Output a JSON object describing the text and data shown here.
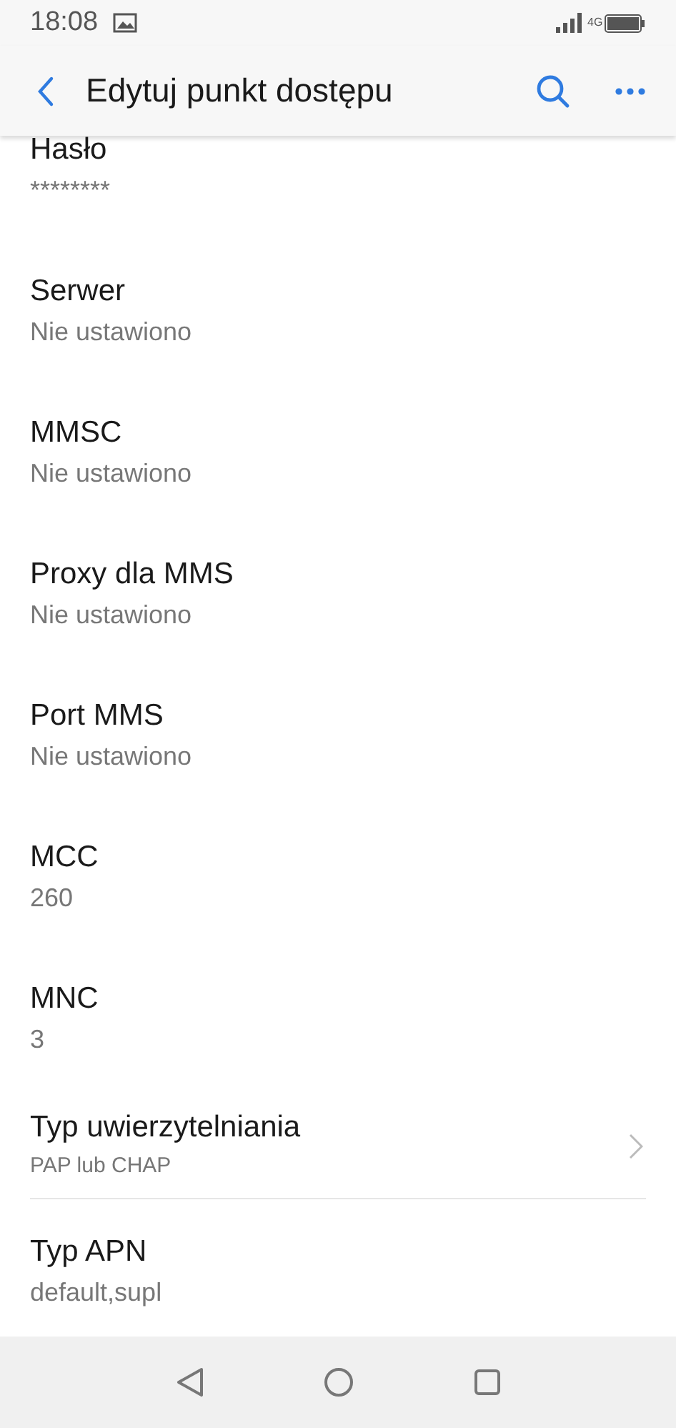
{
  "status_bar": {
    "time": "18:08",
    "network": "4G"
  },
  "app_bar": {
    "title": "Edytuj punkt dostępu"
  },
  "items": [
    {
      "kind": "text",
      "title": "Hasło",
      "value": "********"
    },
    {
      "kind": "text",
      "title": "Serwer",
      "value": "Nie ustawiono"
    },
    {
      "kind": "text",
      "title": "MMSC",
      "value": "Nie ustawiono"
    },
    {
      "kind": "text",
      "title": "Proxy dla MMS",
      "value": "Nie ustawiono"
    },
    {
      "kind": "text",
      "title": "Port MMS",
      "value": "Nie ustawiono"
    },
    {
      "kind": "text",
      "title": "MCC",
      "value": "260"
    },
    {
      "kind": "text",
      "title": "MNC",
      "value": "3"
    },
    {
      "kind": "select",
      "title": "Typ uwierzytelniania",
      "value": "PAP lub CHAP"
    },
    {
      "kind": "text",
      "title": "Typ APN",
      "value": "default,supl"
    }
  ]
}
